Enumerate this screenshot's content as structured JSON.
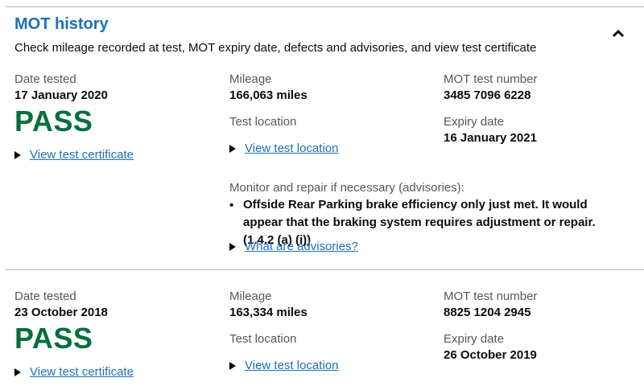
{
  "section": {
    "title": "MOT history",
    "summary": "Check mileage recorded at test, MOT expiry date, defects and advisories, and view test certificate",
    "collapse_icon": "chevron-up-icon"
  },
  "labels": {
    "date_tested": "Date tested",
    "mileage": "Mileage",
    "test_number": "MOT test number",
    "test_location": "Test location",
    "expiry_date": "Expiry date",
    "view_certificate": "View test certificate",
    "view_location": "View test location",
    "advisories_heading": "Monitor and repair if necessary (advisories):",
    "what_are_advisories": "What are advisories?"
  },
  "records": [
    {
      "date_tested": "17 January 2020",
      "result": "PASS",
      "mileage": "166,063 miles",
      "test_number": "3485 7096 6228",
      "expiry_date": "16 January 2021",
      "advisories": [
        "Offside Rear Parking brake efficiency only just met. It would appear that the braking system requires adjustment or repair. (1.4.2 (a) (i))"
      ]
    },
    {
      "date_tested": "23 October 2018",
      "result": "PASS",
      "mileage": "163,334 miles",
      "test_number": "8825 1204 2945",
      "expiry_date": "26 October 2019"
    }
  ],
  "colors": {
    "link": "#1d70b8",
    "pass": "#00703c",
    "secondary_text": "#505a5f",
    "rule": "#b1b4b6"
  }
}
